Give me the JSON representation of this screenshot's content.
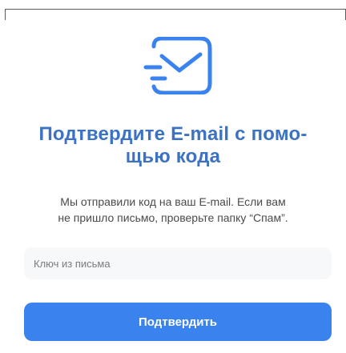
{
  "icon": {
    "name": "mail-check-icon",
    "color": "#3a83ee"
  },
  "heading": {
    "line1": "Подтвердите E-mail с помо-",
    "line2": "щью кода",
    "color": "#3d72c2"
  },
  "description": {
    "line1": "Мы отправили код на ваш E-mail. Если вам",
    "line2": "не пришло письмо, проверьте папку “Спам”."
  },
  "code_input": {
    "placeholder": "Ключ из письма",
    "value": ""
  },
  "confirm_button": {
    "label": "Подтвердить",
    "color": "#3a83ee"
  }
}
